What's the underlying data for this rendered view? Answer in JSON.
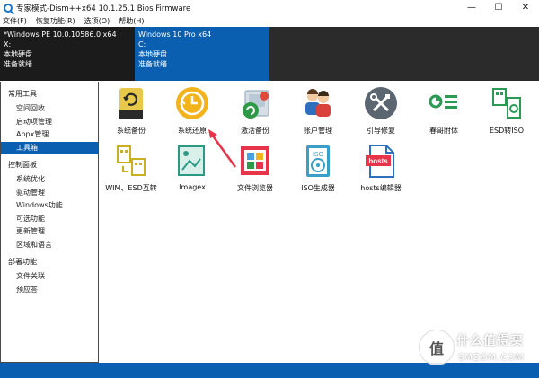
{
  "window": {
    "title": "专家模式-Dism++x64 10.1.25.1 Bios Firmware",
    "minimize": "—",
    "maximize": "☐",
    "close": "✕"
  },
  "menu": [
    "文件(F)",
    "恢复功能(R)",
    "选项(O)",
    "帮助(H)"
  ],
  "images": [
    {
      "name": "*Windows PE 10.0.10586.0 x64",
      "drive": "X:",
      "type": "本地硬盘",
      "status": "准备就绪"
    },
    {
      "name": "Windows 10 Pro x64",
      "drive": "C:",
      "type": "本地硬盘",
      "status": "准备就绪"
    }
  ],
  "sidebar": {
    "groups": [
      {
        "label": "常用工具",
        "items": [
          "空间回收",
          "启动项管理",
          "Appx管理",
          "工具箱"
        ]
      },
      {
        "label": "控制面板",
        "items": [
          "系统优化",
          "驱动管理",
          "Windows功能",
          "可选功能",
          "更新管理",
          "区域和语言"
        ]
      },
      {
        "label": "部署功能",
        "items": [
          "文件关联",
          "预应答"
        ]
      }
    ],
    "selected": "工具箱"
  },
  "tools": [
    {
      "label": "系统备份",
      "icon": "backup-drive-icon"
    },
    {
      "label": "系统还原",
      "icon": "restore-clock-icon"
    },
    {
      "label": "激活备份",
      "icon": "activation-backup-icon"
    },
    {
      "label": "账户管理",
      "icon": "accounts-icon"
    },
    {
      "label": "引导修复",
      "icon": "boot-repair-icon"
    },
    {
      "label": "春哥附体",
      "icon": "super-admin-icon"
    },
    {
      "label": "ESD转ISO",
      "icon": "esd-to-iso-icon"
    },
    {
      "label": "WIM、ESD互转",
      "icon": "wim-esd-convert-icon"
    },
    {
      "label": "Imagex",
      "icon": "imagex-icon"
    },
    {
      "label": "文件浏览器",
      "icon": "file-browser-icon"
    },
    {
      "label": "ISO生成器",
      "icon": "iso-maker-icon"
    },
    {
      "label": "hosts编辑器",
      "icon": "hosts-editor-icon"
    }
  ],
  "hosts_badge": "hosts",
  "iso_badge": "ISO",
  "watermark": {
    "logo": "值",
    "line1": "什么值得买",
    "line2": "SMZDM.COM"
  }
}
